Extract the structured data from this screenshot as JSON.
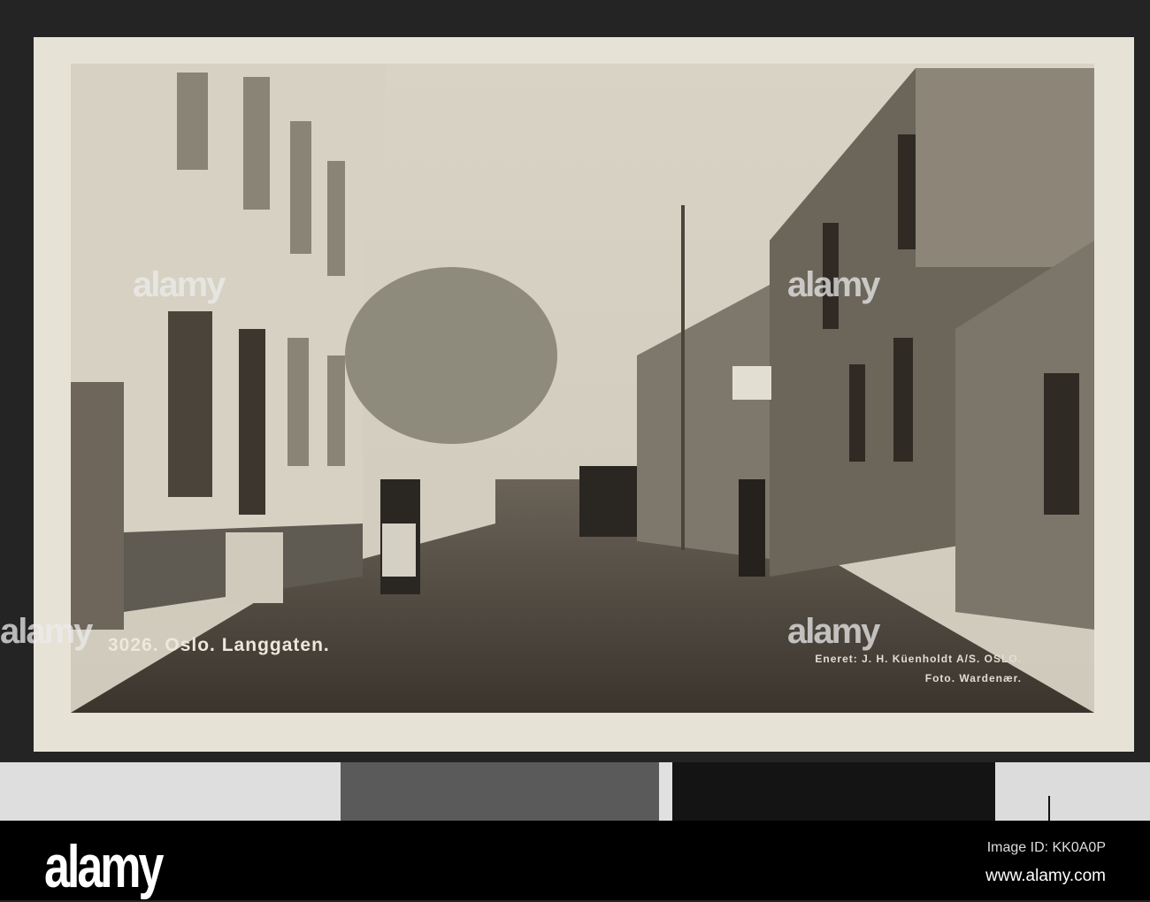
{
  "postcard": {
    "caption": "3026. Oslo. Langgaten.",
    "credit_line1": "Eneret: J. H. Küenholdt A/S. OSLO.",
    "credit_line2": "Foto. Wardenær."
  },
  "watermark": "alamy",
  "footer": {
    "logo": "alamy",
    "image_id": "Image ID: KK0A0P",
    "url": "www.alamy.com"
  }
}
